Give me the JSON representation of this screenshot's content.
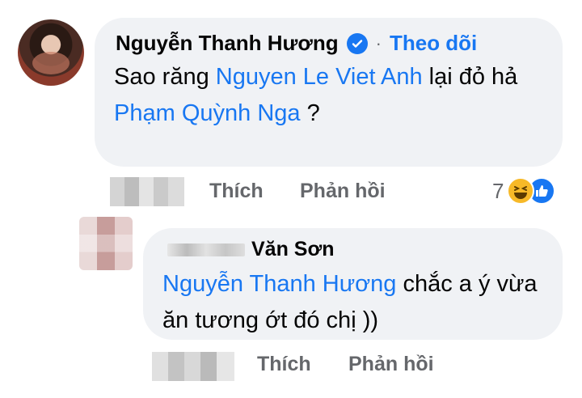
{
  "comment1": {
    "author": "Nguyễn Thanh Hương",
    "dot": "·",
    "follow_label": "Theo dõi",
    "text_prefix": "Sao răng ",
    "mention1": "Nguyen Le Viet Anh",
    "text_middle": " lại đỏ hả",
    "mention2": "Phạm Quỳnh Nga",
    "text_suffix": " ?",
    "like_label": "Thích",
    "reply_label": "Phản hồi",
    "reaction_count": "7",
    "reaction_icons": [
      "haha-icon",
      "like-icon"
    ]
  },
  "reply1": {
    "author_visible": "Văn Sơn",
    "mention": "Nguyễn Thanh Hương",
    "text": "  chắc a ý vừa ăn tương ớt đó chị ))",
    "like_label": "Thích",
    "reply_label": "Phản hồi"
  },
  "colors": {
    "bubble": "#f0f2f5",
    "link": "#1877f2",
    "muted": "#65676b"
  }
}
